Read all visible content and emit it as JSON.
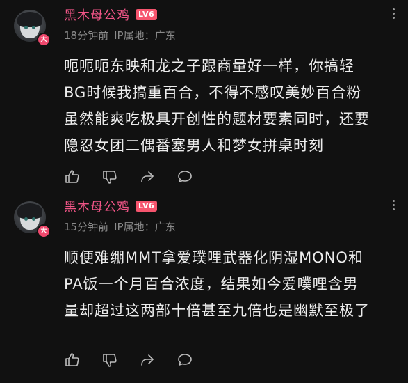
{
  "comments": [
    {
      "username": "黑木母公鸡",
      "level": "LV6",
      "avatar_badge": "大",
      "time": "18分钟前",
      "location_label": "IP属地：",
      "location": "广东",
      "lines": [
        "呃呃呃东映和龙之子跟商量好一样，你搞轻",
        "BG时候我搞重百合，不得不感叹美妙百合粉",
        "虽然能爽吃极具开创性的题材要素同时，还要",
        "隐忍女团二偶番塞男人和梦女拼桌时刻"
      ]
    },
    {
      "username": "黑木母公鸡",
      "level": "LV6",
      "avatar_badge": "大",
      "time": "15分钟前",
      "location_label": "IP属地：",
      "location": "广东",
      "lines": [
        "顺便难绷MMT拿爱璞哩武器化阴湿MONO和",
        "PA饭一个月百合浓度，结果如今爱噗哩含男",
        "量却超过这两部十倍甚至九倍也是幽默至极了"
      ]
    }
  ],
  "icons": {
    "like": "thumbs-up-icon",
    "dislike": "thumbs-down-icon",
    "share": "share-icon",
    "reply": "comment-bubble-icon",
    "more": "more-vertical-icon"
  },
  "colors": {
    "background": "#111111",
    "username": "#f15587",
    "level_badge": "#f6556e",
    "meta_text": "#8a8a8a",
    "body_text": "#ececec"
  }
}
